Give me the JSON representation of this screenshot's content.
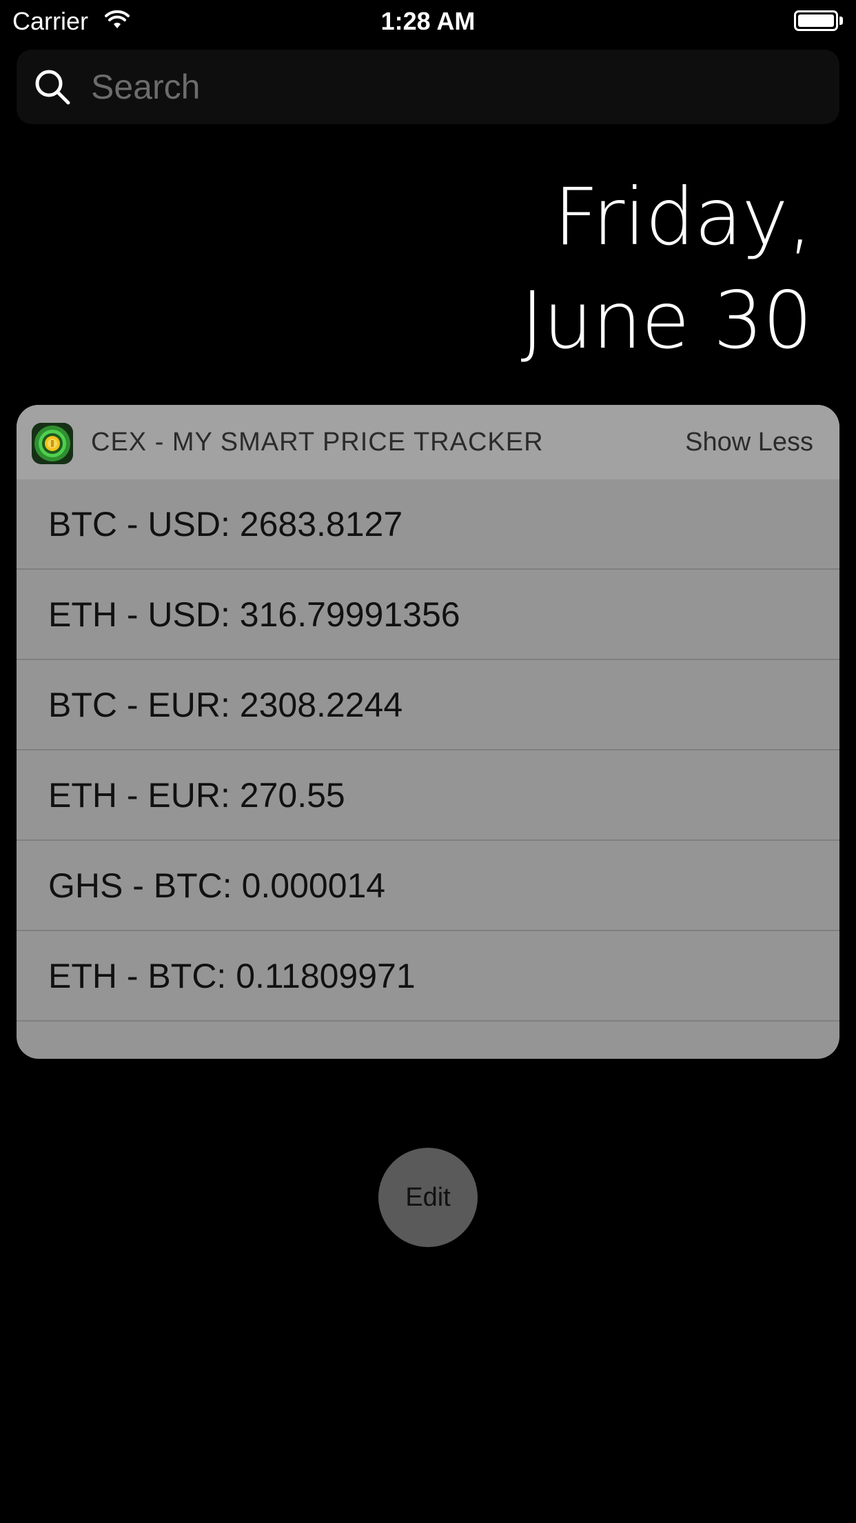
{
  "status_bar": {
    "carrier": "Carrier",
    "time": "1:28 AM",
    "battery_level": 1.0
  },
  "search": {
    "placeholder": "Search"
  },
  "date": {
    "line1": "Friday,",
    "line2": "June 30"
  },
  "widget": {
    "app_name": "CEX - MY SMART PRICE TRACKER",
    "show_less_label": "Show Less",
    "rows": [
      {
        "text": "BTC - USD: 2683.8127"
      },
      {
        "text": "ETH - USD: 316.79991356"
      },
      {
        "text": "BTC - EUR: 2308.2244"
      },
      {
        "text": "ETH - EUR: 270.55"
      },
      {
        "text": "GHS - BTC: 0.000014"
      },
      {
        "text": "ETH - BTC: 0.11809971"
      }
    ]
  },
  "edit_button": {
    "label": "Edit"
  },
  "icons": {
    "wifi": "wifi-icon",
    "battery": "battery-icon",
    "search": "search-icon",
    "app": "app-icon"
  },
  "colors": {
    "background": "#000000",
    "widget_body": "#959595",
    "widget_header": "#a2a2a2",
    "edit_button": "#5a5a5a",
    "app_icon_accent": "#3fbf3f",
    "app_icon_coin": "#f2c21b"
  }
}
